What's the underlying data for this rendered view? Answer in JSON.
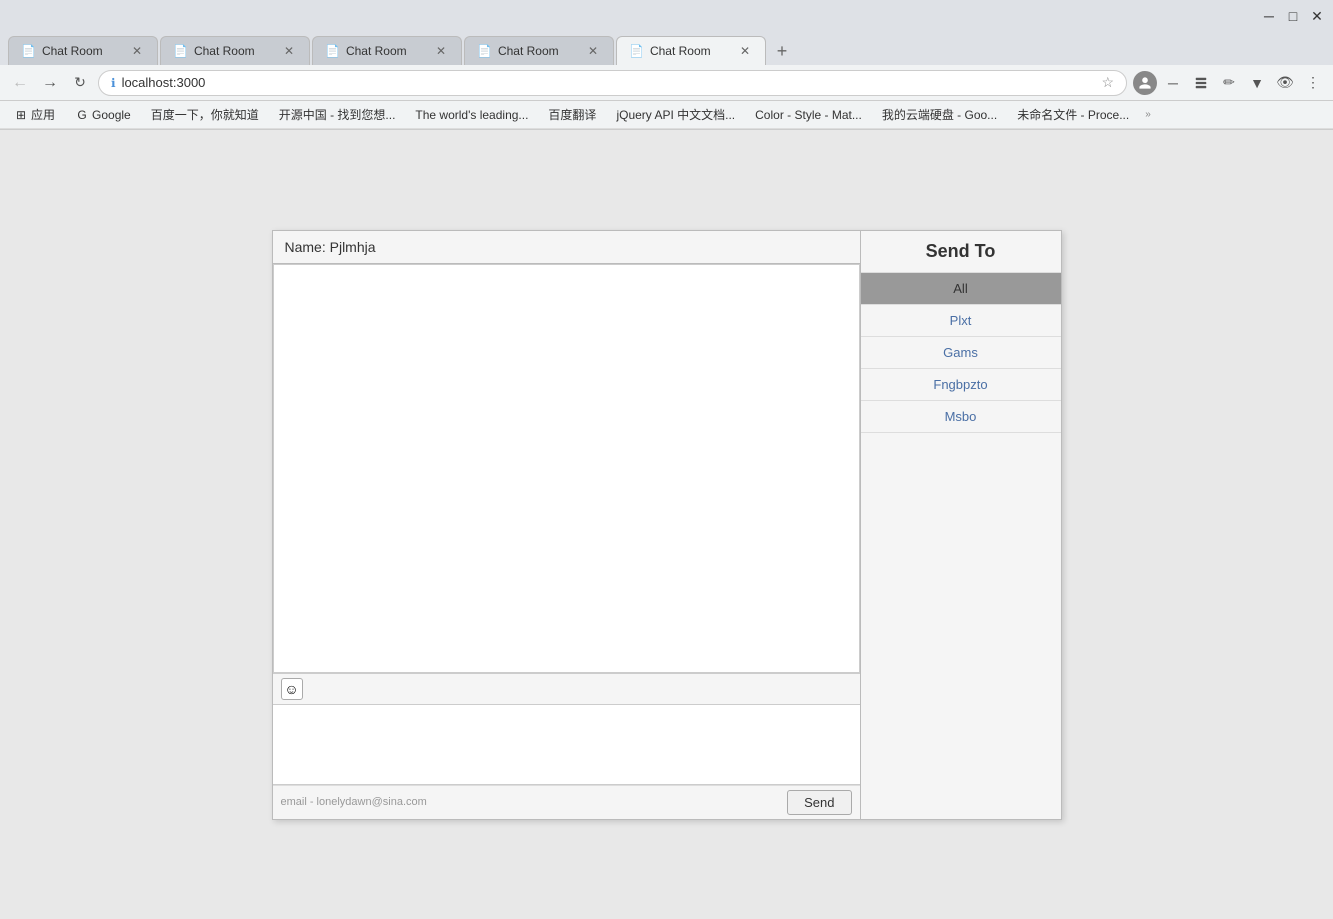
{
  "browser": {
    "tabs": [
      {
        "id": 1,
        "title": "Chat Room",
        "active": false
      },
      {
        "id": 2,
        "title": "Chat Room",
        "active": false
      },
      {
        "id": 3,
        "title": "Chat Room",
        "active": false
      },
      {
        "id": 4,
        "title": "Chat Room",
        "active": false
      },
      {
        "id": 5,
        "title": "Chat Room",
        "active": true
      }
    ],
    "url": "localhost:3000",
    "title_bar": {
      "minimize": "─",
      "maximize": "□",
      "close": "✕"
    }
  },
  "bookmarks": [
    {
      "label": "应用"
    },
    {
      "label": "Google"
    },
    {
      "label": "百度一下，你就知道"
    },
    {
      "label": "开源中国 - 找到您想..."
    },
    {
      "label": "The world's leading..."
    },
    {
      "label": "百度翻译"
    },
    {
      "label": "jQuery API 中文文档..."
    },
    {
      "label": "Color - Style - Mat..."
    },
    {
      "label": "我的云端硬盘 - Goo..."
    },
    {
      "label": "未命名文件 - Proce..."
    }
  ],
  "chat": {
    "name_label": "Name:",
    "name_value": "Pjlmhja",
    "send_to_header": "Send To",
    "selected_recipient": "All",
    "recipients": [
      {
        "id": "all",
        "label": "All",
        "selected": true
      },
      {
        "id": "plxt",
        "label": "Plxt",
        "selected": false
      },
      {
        "id": "gams",
        "label": "Gams",
        "selected": false
      },
      {
        "id": "fngbpzto",
        "label": "Fngbpzto",
        "selected": false
      },
      {
        "id": "msbo",
        "label": "Msbo",
        "selected": false
      }
    ],
    "footer_email": "email - lonelydawn@sina.com",
    "send_button": "Send",
    "emoji_symbol": "☺",
    "message_placeholder": ""
  }
}
